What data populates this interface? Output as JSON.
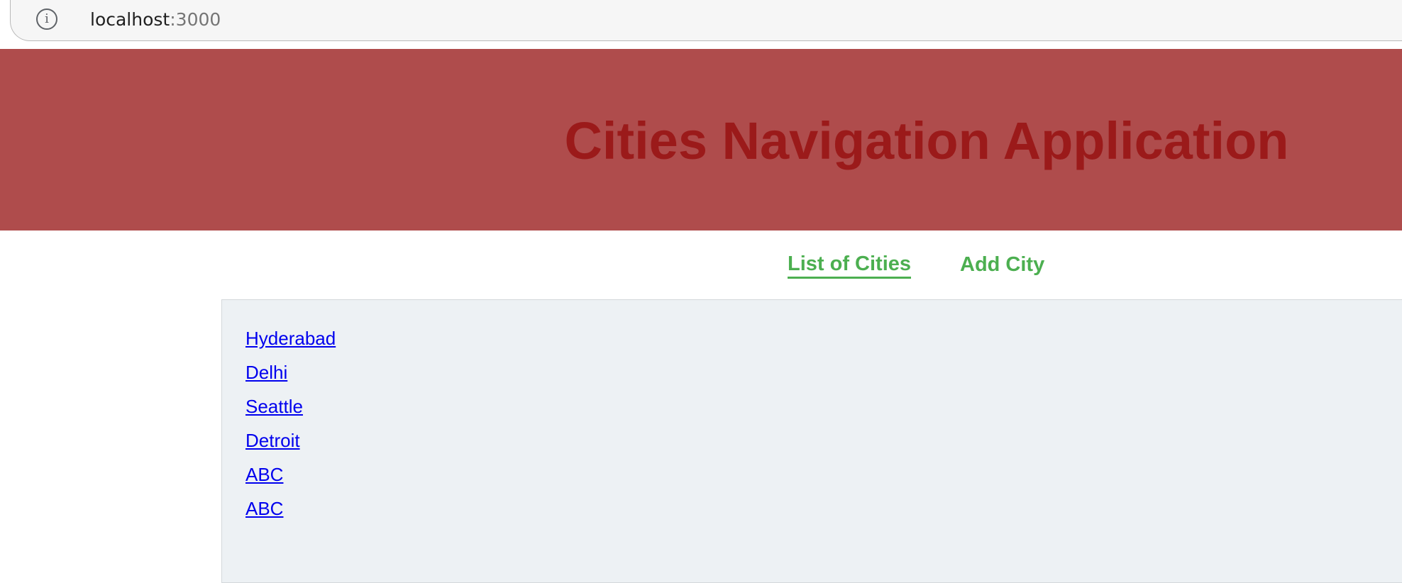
{
  "browser": {
    "url_host": "localhost",
    "url_port": ":3000"
  },
  "header": {
    "title": "Cities Navigation Application"
  },
  "nav": {
    "items": [
      {
        "label": "List of Cities",
        "active": true
      },
      {
        "label": "Add City",
        "active": false
      }
    ]
  },
  "cities": [
    "Hyderabad",
    "Delhi",
    "Seattle",
    "Detroit",
    "ABC",
    "ABC"
  ],
  "colors": {
    "banner_bg": "#af4c4c",
    "title": "#9b1a1a",
    "nav_link": "#4caf50",
    "panel_bg": "#edf1f4",
    "city_link": "#0000ee"
  }
}
